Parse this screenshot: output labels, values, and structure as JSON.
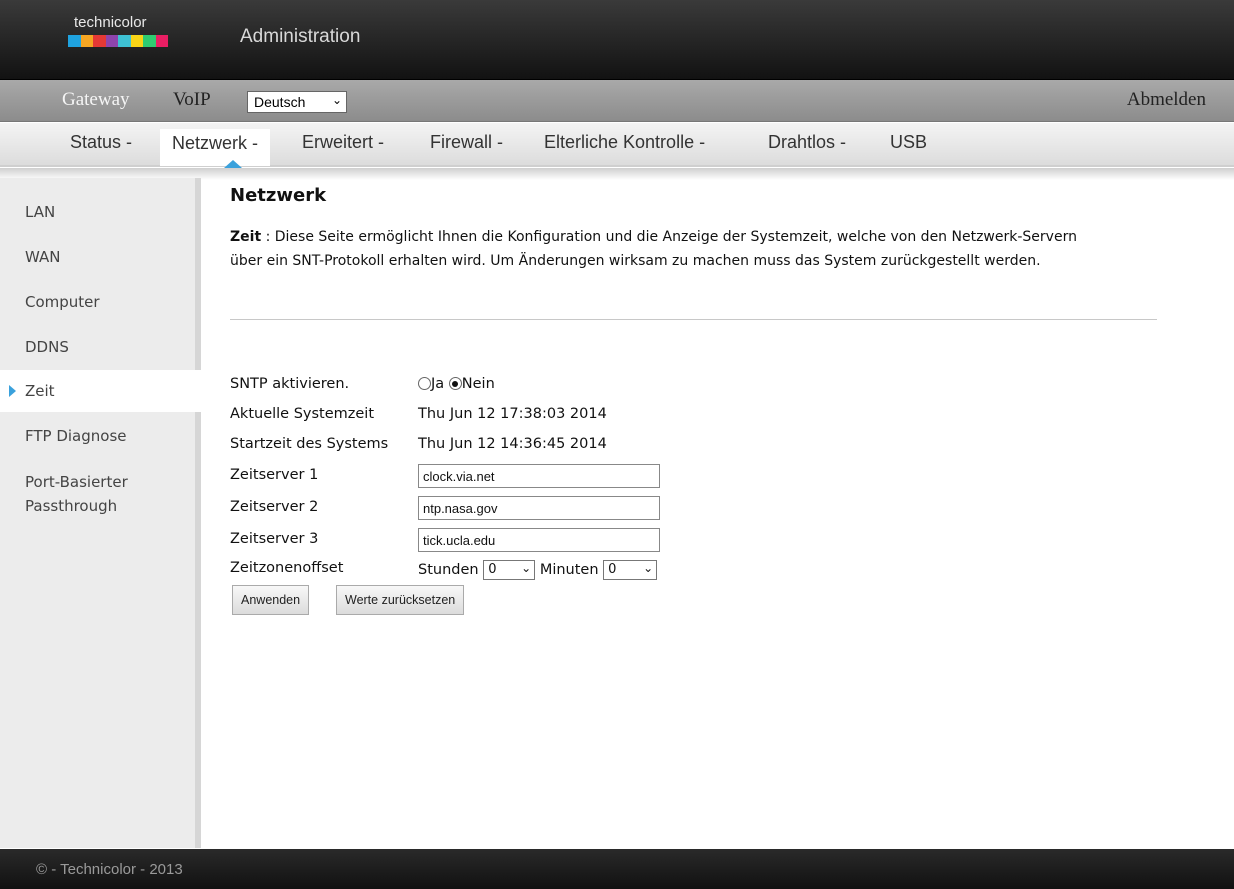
{
  "header": {
    "logo_text": "technicolor",
    "logo_colors": [
      "#1fa3e0",
      "#f5a623",
      "#e53935",
      "#8e44ad",
      "#3ec1d3",
      "#f7d417",
      "#2ecc71",
      "#e91e63"
    ],
    "title": "Administration"
  },
  "menubar": {
    "gateway": "Gateway",
    "voip": "VoIP",
    "language": "Deutsch",
    "logout": "Abmelden"
  },
  "tabs": [
    {
      "label": "Status -"
    },
    {
      "label": "Netzwerk -"
    },
    {
      "label": "Erweitert -"
    },
    {
      "label": "Firewall -"
    },
    {
      "label": "Elterliche Kontrolle -"
    },
    {
      "label": "Drahtlos -"
    },
    {
      "label": "USB"
    }
  ],
  "sidebar": {
    "items": [
      {
        "label": "LAN"
      },
      {
        "label": "WAN"
      },
      {
        "label": "Computer"
      },
      {
        "label": "DDNS"
      },
      {
        "label": "Zeit"
      },
      {
        "label": "FTP Diagnose"
      },
      {
        "label": "Port-Basierter"
      },
      {
        "label": "Passthrough"
      }
    ]
  },
  "main": {
    "title": "Netzwerk",
    "desc_bold": "Zeit",
    "desc_text": " :  Diese Seite ermöglicht Ihnen die Konfiguration und die Anzeige der Systemzeit, welche von den Netzwerk-Servern über ein SNT-Protokoll erhalten wird. Um Änderungen wirksam zu machen muss das System zurückgestellt werden."
  },
  "form": {
    "sntp_label": "SNTP aktivieren.",
    "radio_yes": "Ja",
    "radio_no": "Nein",
    "sntp_selected": "Nein",
    "systime_label": "Aktuelle Systemzeit",
    "systime_value": "Thu Jun 12 17:38:03 2014",
    "starttime_label": "Startzeit des Systems",
    "starttime_value": "Thu Jun 12 14:36:45 2014",
    "server1_label": "Zeitserver 1",
    "server1_value": "clock.via.net",
    "server2_label": "Zeitserver 2",
    "server2_value": "ntp.nasa.gov",
    "server3_label": "Zeitserver 3",
    "server3_value": "tick.ucla.edu",
    "offset_label": "Zeitzonenoffset",
    "hours_label": "Stunden",
    "hours_value": "0",
    "minutes_label": "Minuten",
    "minutes_value": "0",
    "apply_button": "Anwenden",
    "reset_button": "Werte zurücksetzen"
  },
  "footer": {
    "text": "© - Technicolor - 2013"
  }
}
